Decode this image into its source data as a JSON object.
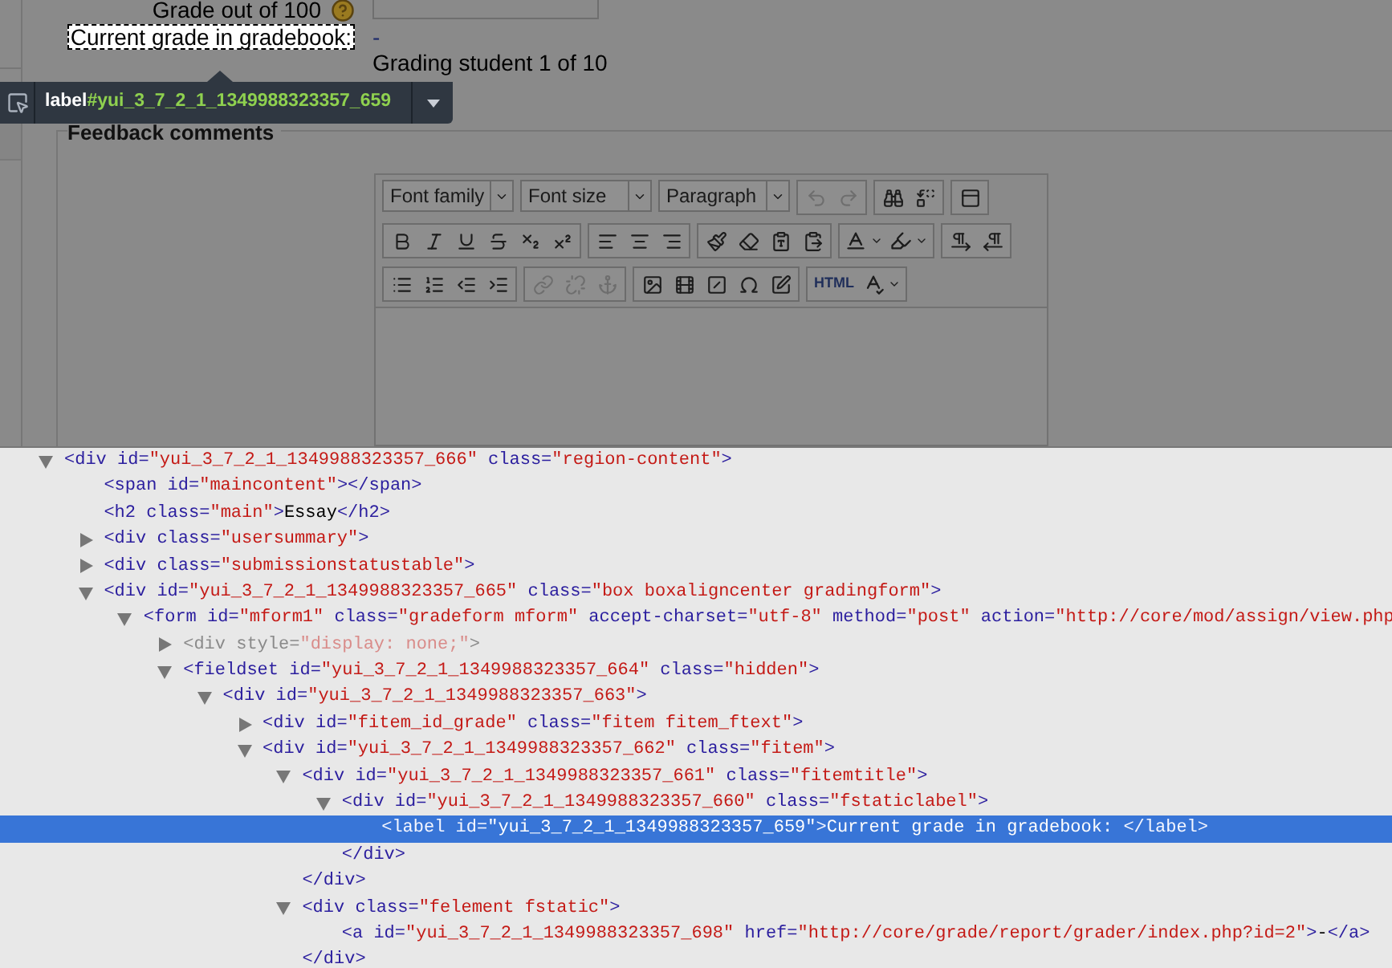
{
  "form": {
    "grade_label": "Grade out of 100",
    "current_label": "Current grade in gradebook:",
    "current_value": "-",
    "grading_status": "Grading student 1 of 10",
    "feedback_legend": "Feedback comments"
  },
  "inspector": {
    "tag": "label",
    "id": "#yui_3_7_2_1_1349988323357_659"
  },
  "toolbar": [
    [
      [
        {
          "kind": "select",
          "label": "Font family"
        }
      ],
      [
        {
          "kind": "select",
          "label": "Font size"
        }
      ],
      [
        {
          "kind": "select",
          "label": "Paragraph"
        }
      ],
      [
        {
          "kind": "button",
          "disabled": true
        },
        {
          "kind": "button",
          "disabled": true
        }
      ],
      [
        {
          "kind": "button",
          "disabled": false
        },
        {
          "kind": "button",
          "disabled": false
        }
      ],
      [
        {
          "kind": "button",
          "disabled": false
        }
      ]
    ],
    [
      [
        {
          "kind": "button",
          "disabled": false
        },
        {
          "kind": "button",
          "disabled": false
        },
        {
          "kind": "button",
          "disabled": false
        },
        {
          "kind": "button",
          "disabled": false
        },
        {
          "kind": "button",
          "disabled": false
        },
        {
          "kind": "button",
          "disabled": false
        }
      ],
      [
        {
          "kind": "button",
          "disabled": false
        },
        {
          "kind": "button",
          "disabled": false
        },
        {
          "kind": "button",
          "disabled": false
        }
      ],
      [
        {
          "kind": "button",
          "disabled": false
        },
        {
          "kind": "button",
          "disabled": false
        },
        {
          "kind": "button",
          "disabled": false
        },
        {
          "kind": "button",
          "disabled": false
        }
      ],
      [
        {
          "kind": "split",
          "disabled": false
        },
        {
          "kind": "split",
          "disabled": false
        }
      ],
      [
        {
          "kind": "button",
          "disabled": false
        },
        {
          "kind": "button",
          "disabled": false
        }
      ]
    ],
    [
      [
        {
          "kind": "button",
          "disabled": false
        },
        {
          "kind": "button",
          "disabled": false
        },
        {
          "kind": "button",
          "disabled": false
        },
        {
          "kind": "button",
          "disabled": false
        }
      ],
      [
        {
          "kind": "button",
          "disabled": true
        },
        {
          "kind": "button",
          "disabled": true
        },
        {
          "kind": "button",
          "disabled": true
        }
      ],
      [
        {
          "kind": "button",
          "disabled": false
        },
        {
          "kind": "button",
          "disabled": false
        },
        {
          "kind": "button",
          "disabled": false
        },
        {
          "kind": "button",
          "disabled": false
        },
        {
          "kind": "button",
          "disabled": false
        }
      ],
      [
        {
          "kind": "text",
          "label": "HTML"
        },
        {
          "kind": "split",
          "disabled": false
        }
      ]
    ]
  ],
  "dom_tree": [
    {
      "tokens": [
        {
          "kind": "tag",
          "text": "<div"
        },
        {
          "kind": "attr",
          "text": " id="
        },
        {
          "kind": "value",
          "text": "\"yui_3_7_2_1_1349988323357_666\""
        },
        {
          "kind": "attr",
          "text": " class="
        },
        {
          "kind": "value",
          "text": "\"region-content\""
        },
        {
          "kind": "tag",
          "text": ">"
        }
      ],
      "expanded": true,
      "selected": false,
      "children": [
        {
          "tokens": [
            {
              "kind": "tag",
              "text": "<span"
            },
            {
              "kind": "attr",
              "text": " id="
            },
            {
              "kind": "value",
              "text": "\"maincontent\""
            },
            {
              "kind": "tag",
              "text": "></span>"
            }
          ],
          "selected": false
        },
        {
          "tokens": [
            {
              "kind": "tag",
              "text": "<h2"
            },
            {
              "kind": "attr",
              "text": " class="
            },
            {
              "kind": "value",
              "text": "\"main\""
            },
            {
              "kind": "tag",
              "text": ">"
            },
            {
              "kind": "text",
              "text": "Essay"
            },
            {
              "kind": "tag",
              "text": "</h2>"
            }
          ],
          "selected": false
        },
        {
          "tokens": [
            {
              "kind": "tag",
              "text": "<div"
            },
            {
              "kind": "attr",
              "text": " class="
            },
            {
              "kind": "value",
              "text": "\"usersummary\""
            },
            {
              "kind": "tag",
              "text": ">"
            }
          ],
          "expanded": false,
          "selected": false
        },
        {
          "tokens": [
            {
              "kind": "tag",
              "text": "<div"
            },
            {
              "kind": "attr",
              "text": " class="
            },
            {
              "kind": "value",
              "text": "\"submissionstatustable\""
            },
            {
              "kind": "tag",
              "text": ">"
            }
          ],
          "expanded": false,
          "selected": false
        },
        {
          "tokens": [
            {
              "kind": "tag",
              "text": "<div"
            },
            {
              "kind": "attr",
              "text": " id="
            },
            {
              "kind": "value",
              "text": "\"yui_3_7_2_1_1349988323357_665\""
            },
            {
              "kind": "attr",
              "text": " class="
            },
            {
              "kind": "value",
              "text": "\"box boxaligncenter gradingform\""
            },
            {
              "kind": "tag",
              "text": ">"
            }
          ],
          "expanded": true,
          "selected": false,
          "children": [
            {
              "tokens": [
                {
                  "kind": "tag",
                  "text": "<form"
                },
                {
                  "kind": "attr",
                  "text": " id="
                },
                {
                  "kind": "value",
                  "text": "\"mform1\""
                },
                {
                  "kind": "attr",
                  "text": " class="
                },
                {
                  "kind": "value",
                  "text": "\"gradeform mform\""
                },
                {
                  "kind": "attr",
                  "text": " accept-charset="
                },
                {
                  "kind": "value",
                  "text": "\"utf-8\""
                },
                {
                  "kind": "attr",
                  "text": " method="
                },
                {
                  "kind": "value",
                  "text": "\"post\""
                },
                {
                  "kind": "attr",
                  "text": " action="
                },
                {
                  "kind": "value",
                  "text": "\"http://core/mod/assign/view.php"
                }
              ],
              "expanded": true,
              "selected": false,
              "children": [
                {
                  "tokens": [
                    {
                      "kind": "tag",
                      "text": "<div"
                    },
                    {
                      "kind": "attr",
                      "text": " style="
                    },
                    {
                      "kind": "value",
                      "text": "\"display: none;\""
                    },
                    {
                      "kind": "tag",
                      "text": ">"
                    }
                  ],
                  "expanded": false,
                  "dimmed": true,
                  "selected": false
                },
                {
                  "tokens": [
                    {
                      "kind": "tag",
                      "text": "<fieldset"
                    },
                    {
                      "kind": "attr",
                      "text": " id="
                    },
                    {
                      "kind": "value",
                      "text": "\"yui_3_7_2_1_1349988323357_664\""
                    },
                    {
                      "kind": "attr",
                      "text": " class="
                    },
                    {
                      "kind": "value",
                      "text": "\"hidden\""
                    },
                    {
                      "kind": "tag",
                      "text": ">"
                    }
                  ],
                  "expanded": true,
                  "selected": false,
                  "children": [
                    {
                      "tokens": [
                        {
                          "kind": "tag",
                          "text": "<div"
                        },
                        {
                          "kind": "attr",
                          "text": " id="
                        },
                        {
                          "kind": "value",
                          "text": "\"yui_3_7_2_1_1349988323357_663\""
                        },
                        {
                          "kind": "tag",
                          "text": ">"
                        }
                      ],
                      "expanded": true,
                      "selected": false,
                      "children": [
                        {
                          "tokens": [
                            {
                              "kind": "tag",
                              "text": "<div"
                            },
                            {
                              "kind": "attr",
                              "text": " id="
                            },
                            {
                              "kind": "value",
                              "text": "\"fitem_id_grade\""
                            },
                            {
                              "kind": "attr",
                              "text": " class="
                            },
                            {
                              "kind": "value",
                              "text": "\"fitem fitem_ftext\""
                            },
                            {
                              "kind": "tag",
                              "text": ">"
                            }
                          ],
                          "expanded": false,
                          "selected": false
                        },
                        {
                          "tokens": [
                            {
                              "kind": "tag",
                              "text": "<div"
                            },
                            {
                              "kind": "attr",
                              "text": " id="
                            },
                            {
                              "kind": "value",
                              "text": "\"yui_3_7_2_1_1349988323357_662\""
                            },
                            {
                              "kind": "attr",
                              "text": " class="
                            },
                            {
                              "kind": "value",
                              "text": "\"fitem\""
                            },
                            {
                              "kind": "tag",
                              "text": ">"
                            }
                          ],
                          "expanded": true,
                          "selected": false,
                          "children": [
                            {
                              "tokens": [
                                {
                                  "kind": "tag",
                                  "text": "<div"
                                },
                                {
                                  "kind": "attr",
                                  "text": " id="
                                },
                                {
                                  "kind": "value",
                                  "text": "\"yui_3_7_2_1_1349988323357_661\""
                                },
                                {
                                  "kind": "attr",
                                  "text": " class="
                                },
                                {
                                  "kind": "value",
                                  "text": "\"fitemtitle\""
                                },
                                {
                                  "kind": "tag",
                                  "text": ">"
                                }
                              ],
                              "expanded": true,
                              "selected": false,
                              "children": [
                                {
                                  "tokens": [
                                    {
                                      "kind": "tag",
                                      "text": "<div"
                                    },
                                    {
                                      "kind": "attr",
                                      "text": " id="
                                    },
                                    {
                                      "kind": "value",
                                      "text": "\"yui_3_7_2_1_1349988323357_660\""
                                    },
                                    {
                                      "kind": "attr",
                                      "text": " class="
                                    },
                                    {
                                      "kind": "value",
                                      "text": "\"fstaticlabel\""
                                    },
                                    {
                                      "kind": "tag",
                                      "text": ">"
                                    }
                                  ],
                                  "expanded": true,
                                  "selected": false,
                                  "children": [
                                    {
                                      "tokens": [
                                        {
                                          "kind": "tag",
                                          "text": "<label"
                                        },
                                        {
                                          "kind": "attr",
                                          "text": " id="
                                        },
                                        {
                                          "kind": "value",
                                          "text": "\"yui_3_7_2_1_1349988323357_659\""
                                        },
                                        {
                                          "kind": "tag",
                                          "text": ">"
                                        },
                                        {
                                          "kind": "text",
                                          "text": "Current grade in gradebook: "
                                        },
                                        {
                                          "kind": "tag",
                                          "text": "</label>"
                                        }
                                      ],
                                      "selected": true
                                    }
                                  ]
                                },
                                {
                                  "tokens": [
                                    {
                                      "kind": "tag",
                                      "text": "</div>"
                                    }
                                  ],
                                  "selected": false
                                }
                              ]
                            },
                            {
                              "tokens": [
                                {
                                  "kind": "tag",
                                  "text": "</div>"
                                }
                              ],
                              "selected": false
                            },
                            {
                              "tokens": [
                                {
                                  "kind": "tag",
                                  "text": "<div"
                                },
                                {
                                  "kind": "attr",
                                  "text": " class="
                                },
                                {
                                  "kind": "value",
                                  "text": "\"felement fstatic\""
                                },
                                {
                                  "kind": "tag",
                                  "text": ">"
                                }
                              ],
                              "expanded": true,
                              "selected": false,
                              "children": [
                                {
                                  "tokens": [
                                    {
                                      "kind": "tag",
                                      "text": "<a"
                                    },
                                    {
                                      "kind": "attr",
                                      "text": " id="
                                    },
                                    {
                                      "kind": "value",
                                      "text": "\"yui_3_7_2_1_1349988323357_698\""
                                    },
                                    {
                                      "kind": "attr",
                                      "text": " href="
                                    },
                                    {
                                      "kind": "value",
                                      "text": "\"http://core/grade/report/grader/index.php?id=2\""
                                    },
                                    {
                                      "kind": "tag",
                                      "text": ">"
                                    },
                                    {
                                      "kind": "text",
                                      "text": "-"
                                    },
                                    {
                                      "kind": "tag",
                                      "text": "</a>"
                                    }
                                  ],
                                  "selected": false
                                }
                              ]
                            },
                            {
                              "tokens": [
                                {
                                  "kind": "tag",
                                  "text": "</div>"
                                }
                              ],
                              "selected": false
                            }
                          ]
                        }
                      ]
                    }
                  ]
                }
              ]
            }
          ]
        }
      ]
    }
  ]
}
